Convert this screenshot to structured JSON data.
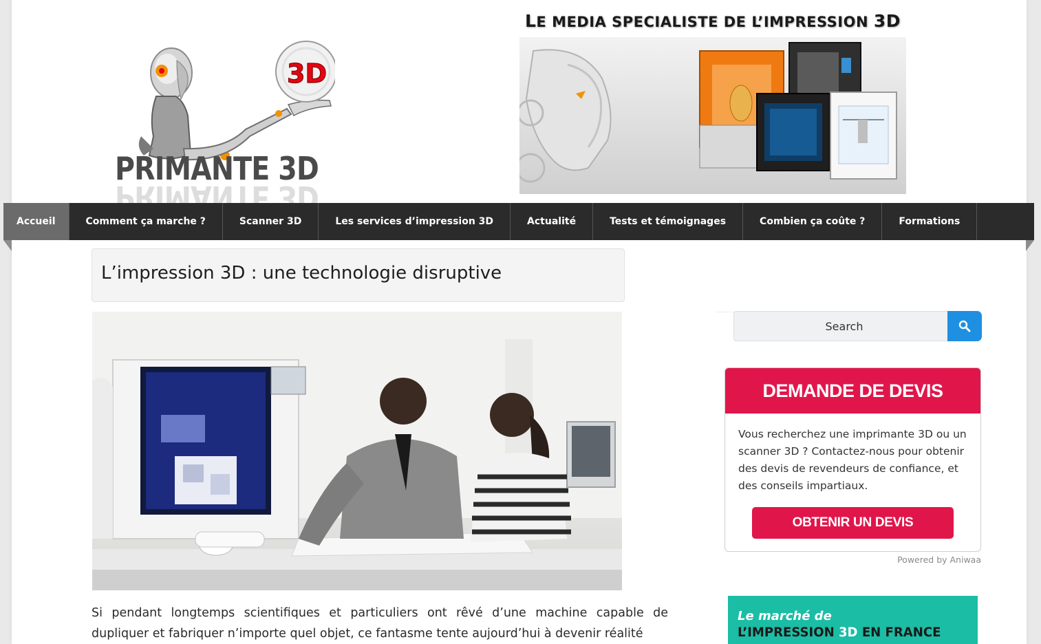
{
  "header": {
    "logo_text": "PRIMANTE 3D",
    "logo_badge": "3D",
    "banner_title_cap": "L",
    "banner_title_rest": "E MEDIA SPECIALISTE DE L’IMPRESSION ",
    "banner_title_3d": "3D"
  },
  "nav": {
    "items": [
      {
        "label": "Accueil",
        "active": true
      },
      {
        "label": "Comment ça marche ?"
      },
      {
        "label": "Scanner 3D"
      },
      {
        "label": "Les services d’impression 3D"
      },
      {
        "label": "Actualité"
      },
      {
        "label": "Tests et témoignages"
      },
      {
        "label": "Combien ça coûte ?"
      },
      {
        "label": "Formations"
      }
    ]
  },
  "article": {
    "title": "L’impression 3D : une technologie disruptive",
    "body": "Si pendant longtemps scientifiques et particuliers ont rêvé d’une machine capable de dupliquer et fabriquer n’importe quel objet, ce fantasme tente aujourd’hui à devenir réalité"
  },
  "sidebar": {
    "search": {
      "placeholder": "Search"
    },
    "devis": {
      "title": "DEMANDE DE DEVIS",
      "text": "Vous recherchez une imprimante 3D ou un scanner 3D ? Contactez-nous pour obtenir des devis de revendeurs de confiance, et des conseils impartiaux.",
      "button": "OBTENIR UN DEVIS",
      "powered": "Powered by Aniwaa"
    },
    "promo": {
      "line1": "Le marché de",
      "line2_a": "L’IMPRESSION ",
      "line2_b": "3D",
      "line2_c": " EN FRANCE"
    }
  },
  "colors": {
    "nav_bg": "#2b2b2b",
    "nav_active": "#6b6b6b",
    "devis_red": "#e0164b",
    "search_blue": "#1e8fe1",
    "promo_teal": "#1bbda5"
  }
}
